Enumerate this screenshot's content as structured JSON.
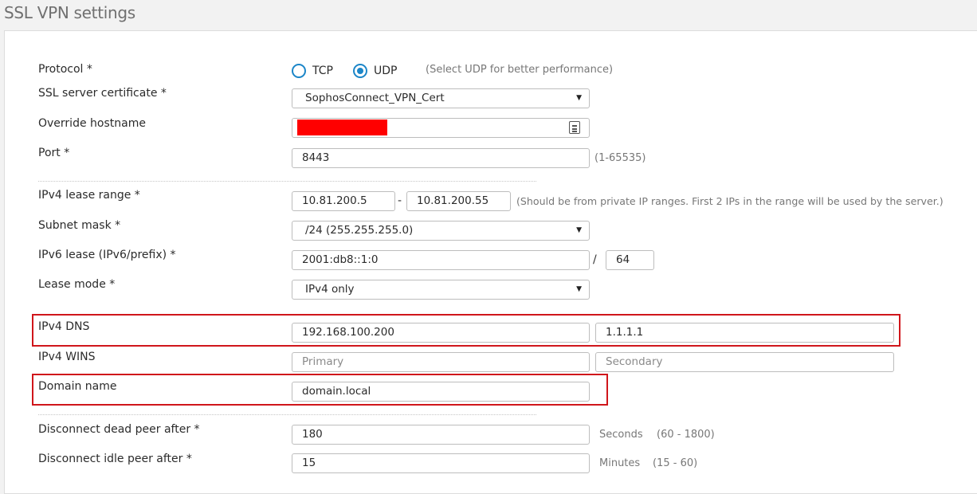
{
  "page": {
    "title": "SSL VPN settings"
  },
  "protocol": {
    "label": "Protocol *",
    "options": [
      "TCP",
      "UDP"
    ],
    "selected": "UDP",
    "hint": "(Select UDP for better performance)"
  },
  "certificate": {
    "label": "SSL server certificate *",
    "value": "SophosConnect_VPN_Cert"
  },
  "hostname": {
    "label": "Override hostname",
    "value": "",
    "icon": "contact-card-icon"
  },
  "port": {
    "label": "Port *",
    "value": "8443",
    "hint": "(1-65535)"
  },
  "ipv4_range": {
    "label": "IPv4 lease range *",
    "start": "10.81.200.5",
    "separator": "-",
    "end": "10.81.200.55",
    "hint": "(Should be from private IP ranges. First 2 IPs in the range will be used by the server.)"
  },
  "subnet": {
    "label": "Subnet mask *",
    "value": "/24 (255.255.255.0)"
  },
  "ipv6_lease": {
    "label": "IPv6 lease (IPv6/prefix) *",
    "value": "2001:db8::1:0",
    "separator": "/",
    "prefix": "64"
  },
  "lease_mode": {
    "label": "Lease mode *",
    "value": "IPv4 only"
  },
  "dns": {
    "label": "IPv4 DNS",
    "primary": "192.168.100.200",
    "secondary": "1.1.1.1"
  },
  "wins": {
    "label": "IPv4 WINS",
    "primary_placeholder": "Primary",
    "secondary_placeholder": "Secondary"
  },
  "domain": {
    "label": "Domain name",
    "value": "domain.local"
  },
  "dead_peer": {
    "label": "Disconnect dead peer after *",
    "value": "180",
    "unit": "Seconds",
    "range": "(60 - 1800)"
  },
  "idle_peer": {
    "label": "Disconnect idle peer after *",
    "value": "15",
    "unit": "Minutes",
    "range": "(15 - 60)"
  },
  "colors": {
    "accent": "#1c86c8",
    "highlight": "#d0161b",
    "redaction": "#ff0000"
  }
}
